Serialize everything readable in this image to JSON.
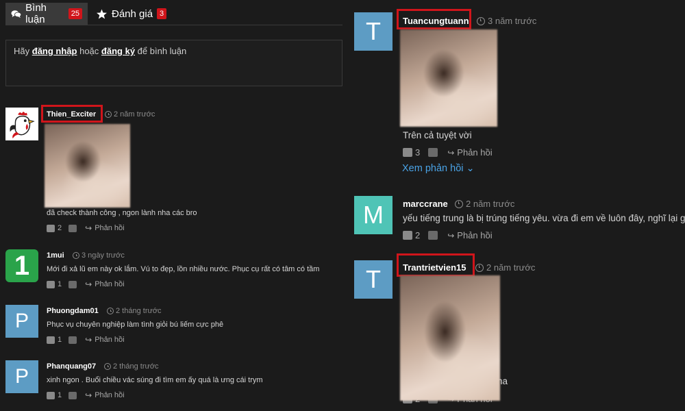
{
  "tabs": [
    {
      "label": "Bình luận",
      "badge": "25"
    },
    {
      "label": "Đánh giá",
      "badge": "3"
    }
  ],
  "login_box": {
    "prefix": "Hãy",
    "login_link": "đăng nhập",
    "middle": "hoặc",
    "register_link": "đăng ký",
    "suffix": "để bình luận"
  },
  "left_comments": [
    {
      "user": "Thien_Exciter",
      "time": "2 năm trước",
      "text": "đã check thành công , ngon lành nha các bro",
      "likes": "2",
      "reply": "Phản hồi"
    },
    {
      "user": "1mui",
      "avatar": "1",
      "time": "3 ngày trước",
      "text": "Mới đi xả lũ em này ok lắm. Vú to đẹp, lồn nhiều nước. Phục cụ rất có tâm có tầm",
      "likes": "1",
      "reply": "Phản hồi"
    },
    {
      "user": "Phuongdam01",
      "avatar": "P",
      "time": "2 tháng trước",
      "text": "Phục vụ chuyên nghiệp làm tình giỏi bú liếm cực phê",
      "likes": "1",
      "reply": "Phản hồi"
    },
    {
      "user": "Phanquang07",
      "avatar": "P",
      "time": "2 tháng trước",
      "text": "xinh ngon . Buổi chiều vác súng đi tìm em ấy quá là ưng cái trym",
      "likes": "1",
      "reply": "Phản hồi"
    }
  ],
  "right_comments": [
    {
      "user": "Tuancungtuann",
      "avatar": "T",
      "time": "3 năm trước",
      "text": "Trên cả tuyệt vời",
      "likes": "3",
      "reply": "Phản hồi",
      "see_replies": "Xem phản hồi"
    },
    {
      "user": "marccrane",
      "avatar": "M",
      "time": "2 năm trước",
      "text": "yếu tiếng trung là bị trúng tiếng yêu. vừa đi em về luôn đây, nghĩ lại giờ",
      "likes": "2",
      "reply": "Phản hồi"
    },
    {
      "user": "Trantrietvien15",
      "avatar": "T",
      "time": "2 năm trước",
      "text_partial": "na",
      "likes": "2",
      "reply": "Phản hồi"
    }
  ],
  "colors": {
    "accent_red": "#d0151b",
    "link_blue": "#4aa3e6",
    "avatar_blue": "#5d9cc4",
    "avatar_teal": "#4fc4b6",
    "avatar_green": "#2aa34a"
  }
}
